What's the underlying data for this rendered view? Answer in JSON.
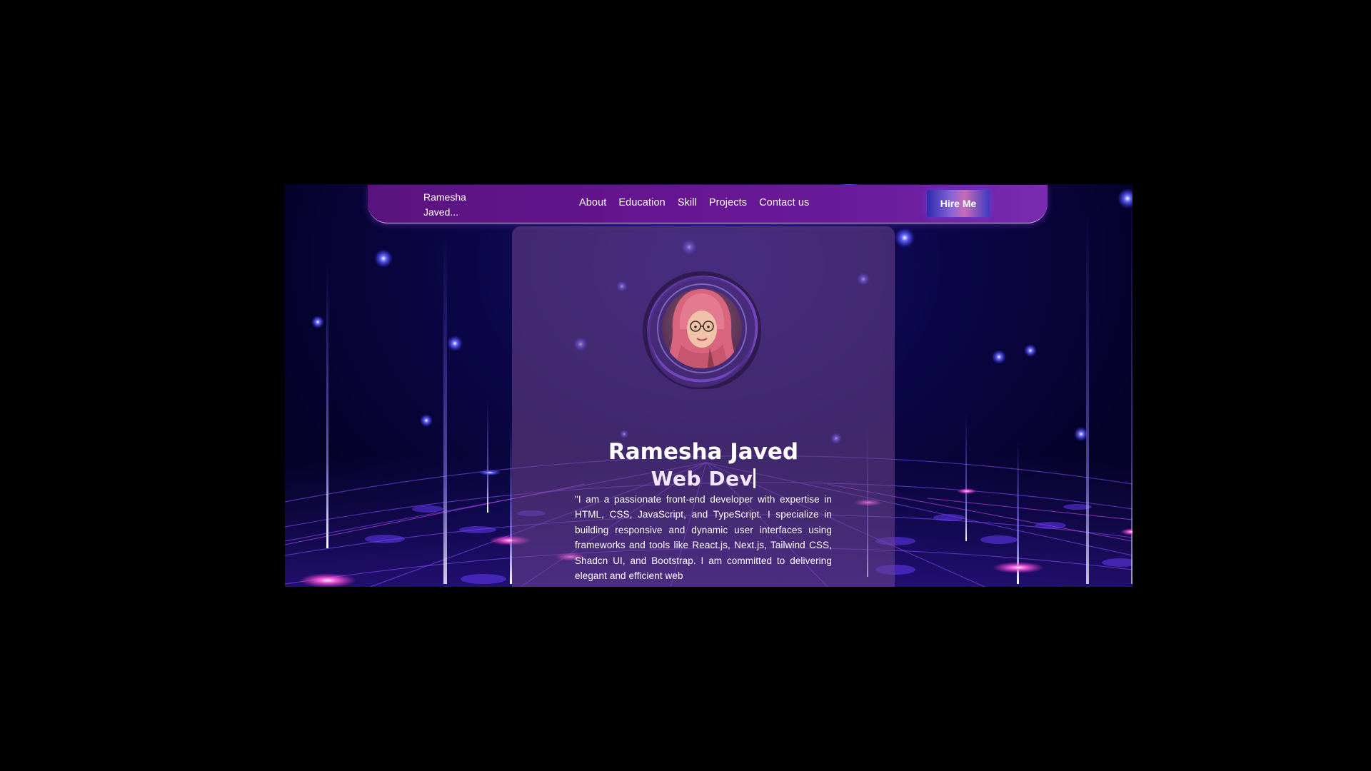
{
  "navbar": {
    "brand": "Ramesha Javed...",
    "links": [
      "About",
      "Education",
      "Skill",
      "Projects",
      "Contact us"
    ],
    "hire_label": "Hire Me"
  },
  "hero": {
    "name": "Ramesha Javed",
    "role": "Web Dev",
    "bio": "\"I am a passionate front-end developer with expertise in HTML, CSS, JavaScript, and TypeScript. I specialize in building responsive and dynamic user interfaces using frameworks and tools like React.js, Next.js, Tailwind CSS, Shadcn UI, and Bootstrap. I am committed to delivering elegant and efficient web"
  },
  "colors": {
    "page_background": "#000000",
    "navbar": "#661592",
    "hero_card": "#6e468c",
    "accent_pink": "#ff4fd8",
    "accent_blue": "#4a4aff"
  },
  "icons": {
    "avatar": "profile-photo-portrait"
  }
}
